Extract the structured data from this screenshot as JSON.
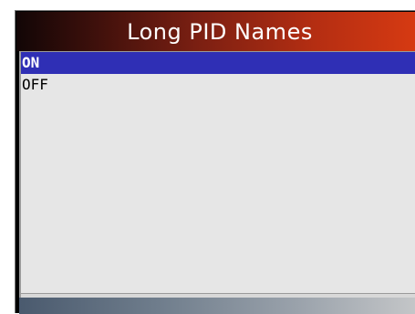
{
  "title": "Long PID Names",
  "options": [
    {
      "label": "ON",
      "selected": true
    },
    {
      "label": "OFF",
      "selected": false
    }
  ],
  "colors": {
    "selection": "#2f2fb5",
    "panel": "#e6e6e6",
    "title_gradient_end": "#d63a12"
  }
}
